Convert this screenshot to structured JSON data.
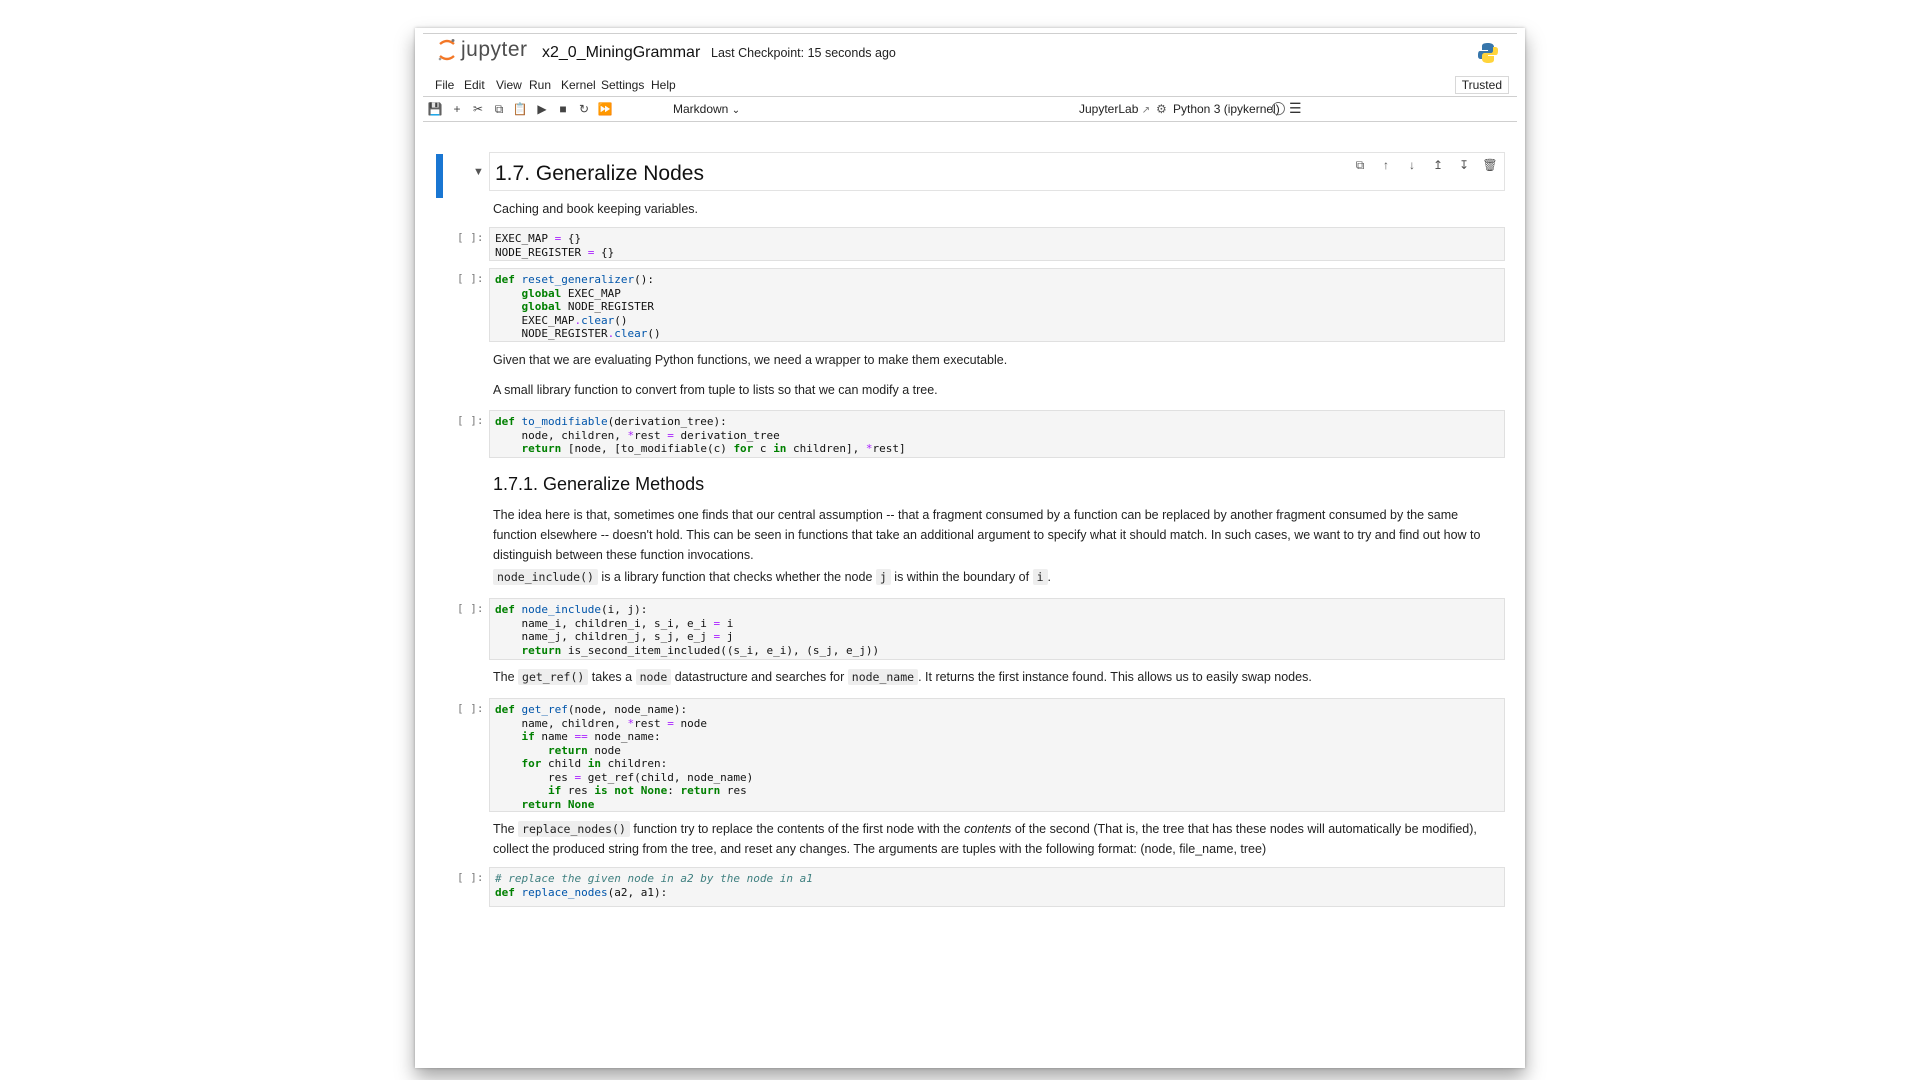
{
  "header": {
    "logo_text": "jupyter",
    "notebook_title": "x2_0_MiningGrammar",
    "checkpoint": "Last Checkpoint: 15 seconds ago"
  },
  "menu": {
    "items": [
      "File",
      "Edit",
      "View",
      "Run",
      "Kernel",
      "Settings",
      "Help"
    ],
    "trusted": "Trusted"
  },
  "toolbar": {
    "cell_type": "Markdown",
    "jupyterlab_link": "JupyterLab",
    "kernel_name": "Python 3 (ipykernel)",
    "icons": [
      "save-icon",
      "add-cell-icon",
      "cut-icon",
      "copy-icon",
      "paste-icon",
      "run-icon",
      "stop-icon",
      "restart-icon",
      "fast-forward-icon"
    ]
  },
  "cells": {
    "heading": "1.7. Generalize Nodes",
    "md1": "Caching and book keeping variables.",
    "prompt": "[ ]:",
    "md2": "Given that we are evaluating Python functions, we need a wrapper to make them executable.",
    "md3": "A small library function to convert from tuple to lists so that we can modify a tree.",
    "subheading": "1.7.1. Generalize Methods",
    "md4": "The idea here is that, sometimes one finds that our central assumption -- that a fragment consumed by a function can be replaced by another fragment consumed by the same function elsewhere -- doesn't hold. This can be seen in functions that take an additional argument to specify what it should match. In such cases, we want to try and find out how to distinguish between these function invocations.",
    "md5_code1": "node_include()",
    "md5_text1": " is a library function that checks whether the node ",
    "md5_code2": "j",
    "md5_text2": " is within the boundary of ",
    "md5_code3": "i",
    "md5_text3": ".",
    "md6_text1": "The ",
    "md6_code1": "get_ref()",
    "md6_text2": " takes a ",
    "md6_code2": "node",
    "md6_text3": " datastructure and searches for ",
    "md6_code3": "node_name",
    "md6_text4": ". It returns the first instance found. This allows us to easily swap nodes.",
    "md7_text1": "The ",
    "md7_code1": "replace_nodes()",
    "md7_text2": " function try to replace the contents of the first node with the ",
    "md7_em": "contents",
    "md7_text3": " of the second (That is, the tree that has these nodes will automatically be modified), collect the produced string from the tree, and reset any changes. The arguments are tuples with the following format: (node, file_name, tree)"
  }
}
